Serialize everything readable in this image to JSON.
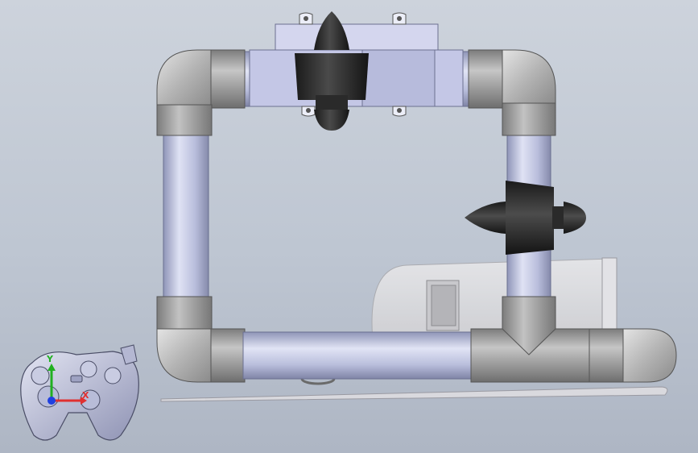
{
  "viewport": {
    "background_top": "#cdd3dc",
    "background_bottom": "#aeb6c4"
  },
  "model": {
    "pipe_color": "#c4c8e4",
    "fitting_color": "#a4a4a4",
    "thruster_color": "#2a2a2a",
    "hull_color": "#dcdcdc"
  },
  "triad": {
    "x_label": "X",
    "y_label": "Y",
    "x_color": "#e03030",
    "y_color": "#20b020",
    "z_color": "#2040e0"
  }
}
